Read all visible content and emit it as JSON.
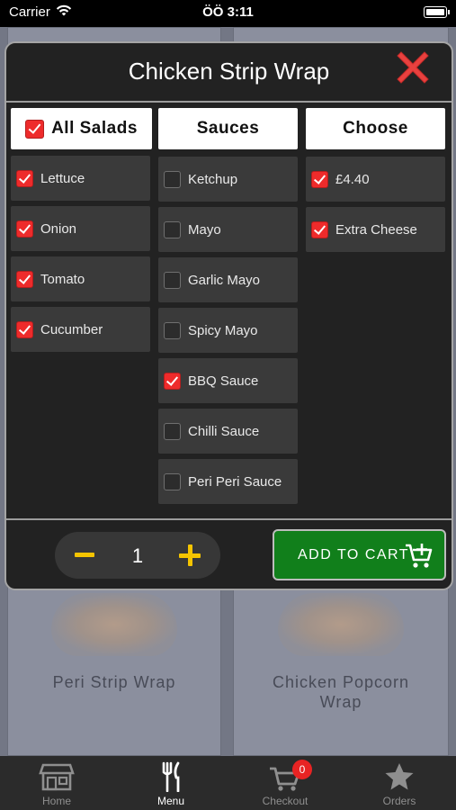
{
  "status_bar": {
    "carrier": "Carrier",
    "time": "ÖÖ 3:11"
  },
  "background_menu": {
    "items": [
      {
        "name": "Peri Strip Wrap"
      },
      {
        "name": "Chicken Popcorn Wrap"
      }
    ]
  },
  "modal": {
    "title": "Chicken Strip Wrap",
    "columns": {
      "salads": {
        "header": "All Salads",
        "header_checked": true,
        "options": [
          {
            "label": "Lettuce",
            "checked": true
          },
          {
            "label": "Onion",
            "checked": true
          },
          {
            "label": "Tomato",
            "checked": true
          },
          {
            "label": "Cucumber",
            "checked": true
          }
        ]
      },
      "sauces": {
        "header": "Sauces",
        "options": [
          {
            "label": "Ketchup",
            "checked": false
          },
          {
            "label": "Mayo",
            "checked": false
          },
          {
            "label": "Garlic Mayo",
            "checked": false
          },
          {
            "label": "Spicy Mayo",
            "checked": false
          },
          {
            "label": "BBQ Sauce",
            "checked": true
          },
          {
            "label": "Chilli Sauce",
            "checked": false
          },
          {
            "label": "Peri Peri Sauce",
            "checked": false
          }
        ]
      },
      "choose": {
        "header": "Choose",
        "options": [
          {
            "label": "£4.40",
            "checked": true
          },
          {
            "label": "Extra Cheese",
            "checked": true
          }
        ]
      }
    },
    "quantity": "1",
    "add_to_cart_label": "ADD TO CART"
  },
  "tabbar": {
    "tabs": [
      {
        "label": "Home",
        "icon": "store-icon",
        "active": false
      },
      {
        "label": "Menu",
        "icon": "fork-knife-icon",
        "active": true
      },
      {
        "label": "Checkout",
        "icon": "cart-icon",
        "active": false,
        "badge": "0"
      },
      {
        "label": "Orders",
        "icon": "star-icon",
        "active": false
      }
    ]
  },
  "colors": {
    "accent_check": "#ee2b2b",
    "add_to_cart": "#117f1b",
    "quantity_controls": "#f5c400",
    "badge": "#e82323"
  }
}
